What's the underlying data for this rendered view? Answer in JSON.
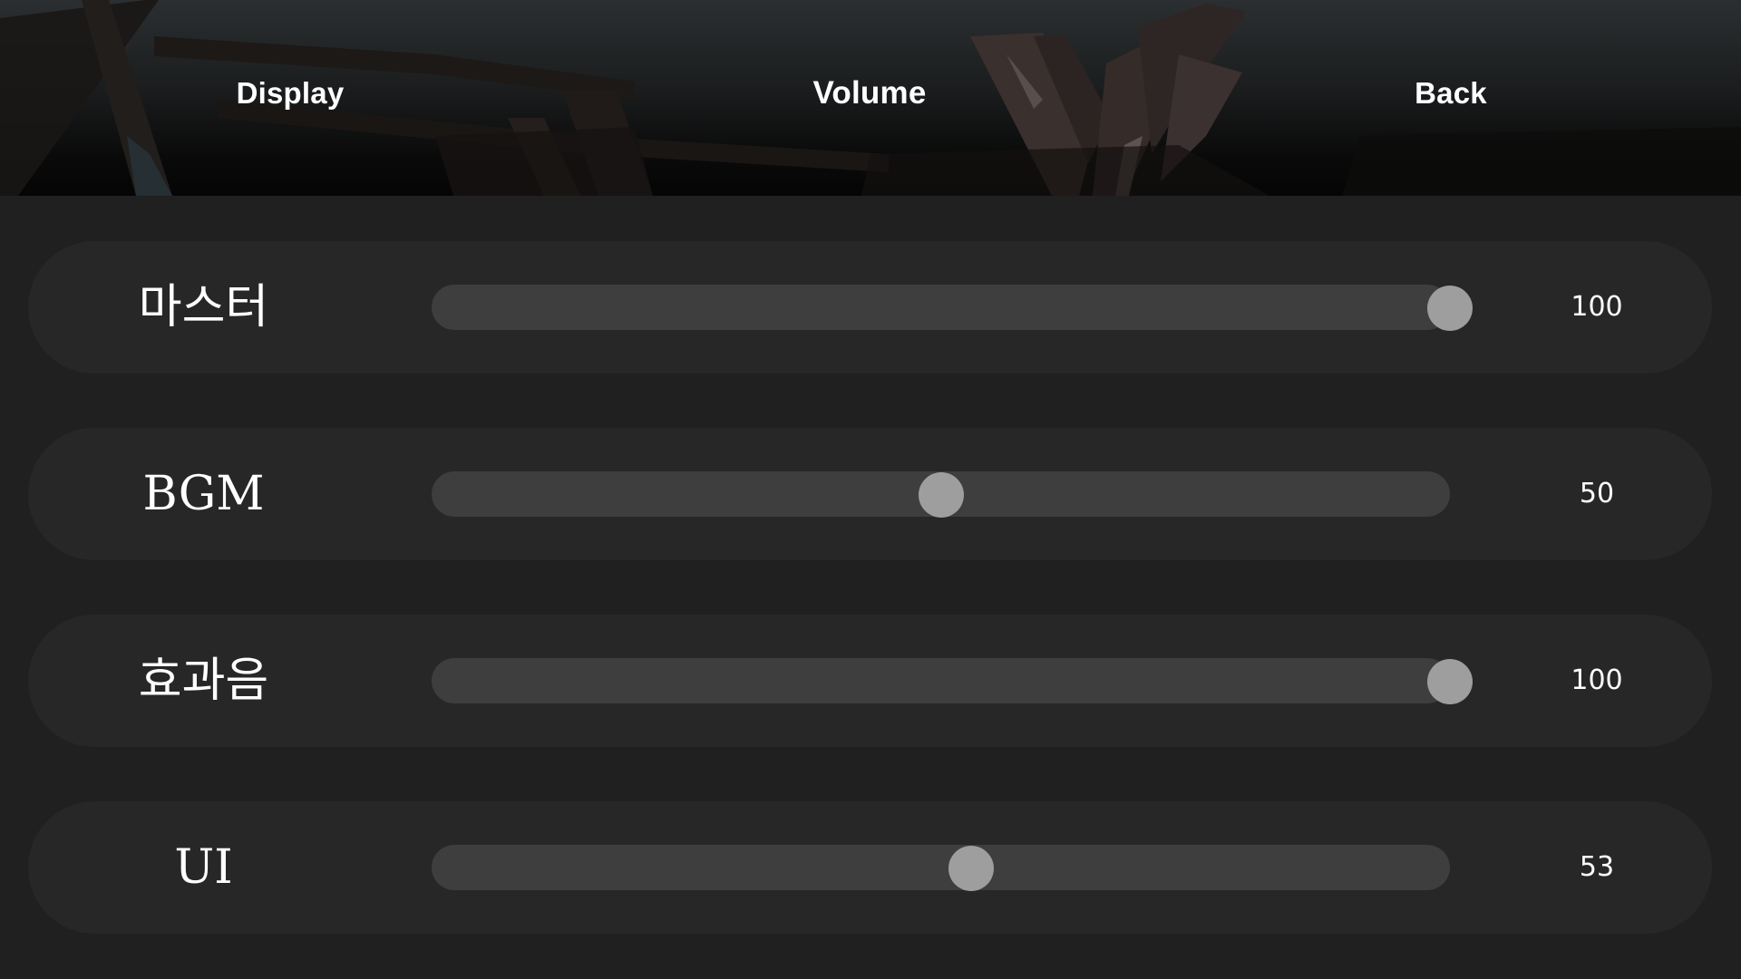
{
  "tabs": [
    {
      "label": "Display"
    },
    {
      "label": "Volume"
    },
    {
      "label": "Back"
    }
  ],
  "active_tab": "Volume",
  "sliders": [
    {
      "label": "마스터",
      "value": "100",
      "level": 100
    },
    {
      "label": "BGM",
      "value": "50",
      "level": 50
    },
    {
      "label": "효과음",
      "value": "100",
      "level": 100
    },
    {
      "label": "UI",
      "value": "53",
      "level": 53
    }
  ],
  "colors": {
    "panel_bg": "#202020",
    "row_bg": "#272727",
    "track": "#3e3e3e",
    "knob": "#9e9e9e",
    "text": "#ffffff"
  }
}
